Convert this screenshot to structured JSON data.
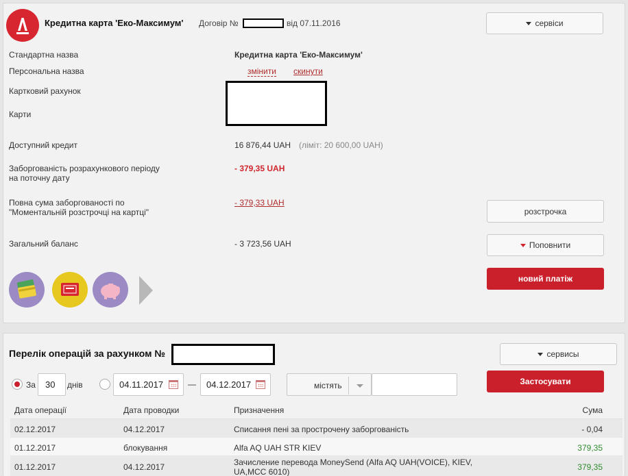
{
  "card": {
    "title": "Кредитна карта 'Еко-Максимум'",
    "contract_label": "Договір №",
    "contract_date": "від 07.11.2016",
    "services_label": "сервіси",
    "rows": {
      "standard_name_label": "Стандартна назва",
      "standard_name_value": "Кредитна карта 'Еко-Максимум'",
      "personal_name_label": "Персональна назва",
      "change_link": "змінити",
      "reset_link": "скинути",
      "account_label": "Картковий рахунок",
      "cards_label": "Карти",
      "available_credit_label": "Доступний кредит",
      "available_credit_value": "16 876,44 UAH",
      "limit_value": "(ліміт: 20 600,00 UAH)",
      "debt_label_1": "Заборгованість розрахункового періоду",
      "debt_label_2": "на поточну дату",
      "debt_value": "-  379,35 UAH",
      "installment_label_1": "Повна сума заборгованості по",
      "installment_label_2": "\"Моментальній розстрочці на картці\"",
      "installment_value": "-  379,33 UAH",
      "balance_label": "Загальний баланс",
      "balance_value": "- 3 723,56 UAH"
    },
    "buttons": {
      "installment": "розстрочка",
      "topup": "Поповнити",
      "new_payment": "новий платіж"
    },
    "shortcut_icons": [
      "cards-icon",
      "card-gift-icon",
      "piggy-bank-icon",
      "next-arrow-icon"
    ]
  },
  "operations": {
    "title": "Перелік операцій за рахунком №",
    "services_label": "сервисы",
    "filter": {
      "for_label": "За",
      "days_value": "30",
      "days_label": "днів",
      "date_from": "04.11.2017",
      "date_sep": "—",
      "date_to": "04.12.2017",
      "contains_label": "містять",
      "search_value": "",
      "apply_label": "Застосувати"
    },
    "columns": [
      "Дата операції",
      "Дата проводки",
      "Призначення",
      "Сума"
    ],
    "rows": [
      {
        "op_date": "02.12.2017",
        "post_date": "04.12.2017",
        "purpose": "Списання пені за прострочену заборгованість",
        "purpose2": "",
        "amount": "- 0,04",
        "amount_color": "#333333"
      },
      {
        "op_date": "01.12.2017",
        "post_date": "блокування",
        "purpose": "Alfa AQ UAH STR KIEV",
        "purpose2": "",
        "amount": "379,35",
        "amount_color": "#2e8b2e"
      },
      {
        "op_date": "01.12.2017",
        "post_date": "04.12.2017",
        "purpose": "Зачисление перевода MoneySend (Alfa AQ UAH(VOICE), KIEV,",
        "purpose2": "UA,MCC 6010)",
        "amount": "379,35",
        "amount_color": "#2e8b2e"
      }
    ]
  },
  "colors": {
    "brand_red": "#c9202c",
    "positive_green": "#2e8b2e",
    "panel_bg": "#f2f2f2"
  }
}
